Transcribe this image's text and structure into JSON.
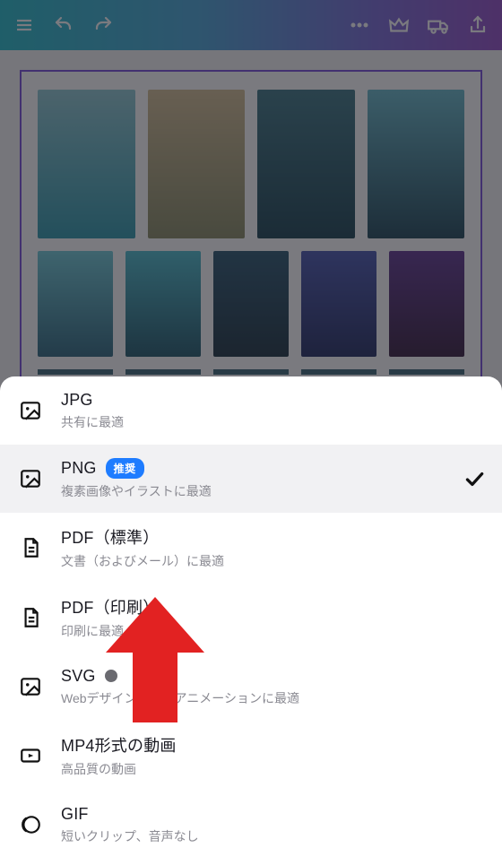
{
  "sheet": {
    "options": [
      {
        "key": "jpg",
        "title": "JPG",
        "subtitle": "共有に最適",
        "icon": "image-icon",
        "highlight": false,
        "badge": null,
        "dot": false,
        "checked": false
      },
      {
        "key": "png",
        "title": "PNG",
        "subtitle": "複素画像やイラストに最適",
        "icon": "image-icon",
        "highlight": true,
        "badge": "推奨",
        "dot": false,
        "checked": true
      },
      {
        "key": "pdf-std",
        "title": "PDF（標準）",
        "subtitle": "文書（およびメール）に最適",
        "icon": "file-icon",
        "highlight": false,
        "badge": null,
        "dot": false,
        "checked": false
      },
      {
        "key": "pdf-print",
        "title": "PDF（印刷）",
        "subtitle": "印刷に最適",
        "icon": "file-icon",
        "highlight": false,
        "badge": null,
        "dot": false,
        "checked": false
      },
      {
        "key": "svg",
        "title": "SVG",
        "subtitle": "Webデザインおよびアニメーションに最適",
        "icon": "image-icon",
        "highlight": false,
        "badge": null,
        "dot": true,
        "checked": false
      },
      {
        "key": "mp4",
        "title": "MP4形式の動画",
        "subtitle": "高品質の動画",
        "icon": "video-icon",
        "highlight": false,
        "badge": null,
        "dot": false,
        "checked": false
      },
      {
        "key": "gif",
        "title": "GIF",
        "subtitle": "短いクリップ、音声なし",
        "icon": "eclipse-icon",
        "highlight": false,
        "badge": null,
        "dot": false,
        "checked": false
      }
    ]
  },
  "annotation": {
    "arrow_color": "#e22222",
    "points_to": "pdf-print"
  }
}
